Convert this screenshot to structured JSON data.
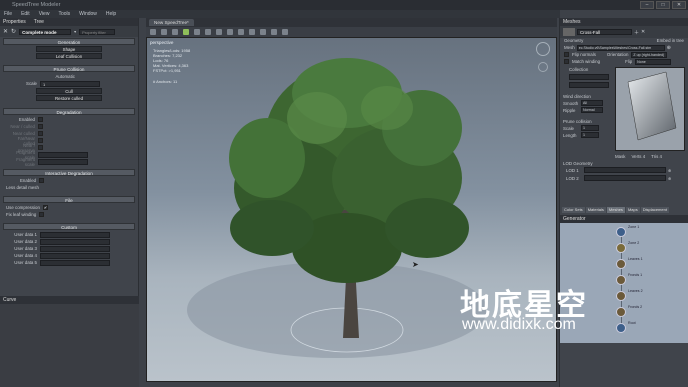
{
  "app_title": "SpeedTree Modeler",
  "menu": [
    "File",
    "Edit",
    "View",
    "Tools",
    "Window",
    "Help"
  ],
  "left_panel": {
    "tabs": [
      "Properties",
      "Tree"
    ],
    "mode_select": "Complete mode",
    "property_filter_placeholder": "Property filter",
    "generation_header": "Generation",
    "shape_button": "Shape",
    "leaf_collision_button": "Leaf Collision",
    "prune_collision_header": "Prune Collision",
    "automatic_label": "Automatic",
    "scale_label": "Scale",
    "scale_value": "1",
    "cull_button": "Cull",
    "restore_culled_button": "Restore culled",
    "degradation_header": "Degradation",
    "degradation_rows": [
      "Enabled",
      "Near / culled",
      "Near culled",
      "Far/Near culled",
      "Near / preserve",
      "Fragment scale",
      "Fragment scale"
    ],
    "interactive_degradation_header": "Interactive Degradation",
    "interactive_rows": [
      "Enabled",
      "Less detail mesh"
    ],
    "file_header": "File",
    "file_rows": [
      "Use compression",
      "Fix leaf winding"
    ],
    "custom_header": "Custom",
    "user_data": [
      "User data 1",
      "User data 2",
      "User data 3",
      "User data 4",
      "User data 5"
    ],
    "bottom_tab": "Curve"
  },
  "viewport": {
    "tab_label": "New SpeedTree*",
    "perspective_label": "perspective",
    "stats": [
      "Triangles/Lods: 1958",
      "Branches: 7,232",
      "Lods: 76",
      "Mat. Vertices: 4,363",
      "FSTPct: >1,951"
    ],
    "extra_label": "# Anchors: 11"
  },
  "right_panel": {
    "header": "Meshes",
    "mesh_name": "Cross-Fall",
    "embed_label": "Embed in tree",
    "geometry_header": "Geometry",
    "mesh_label": "Mesh",
    "mesh_path": "ec.Studio.v6\\Samples\\Meshes\\Cross-Fall.stm",
    "flip_normals": "Flip normals",
    "orientation_label": "Orientation",
    "orientation_value": "Z up (right-handed)",
    "match_winding": "Match winding",
    "flip_label": "Flip",
    "flip_value": "None",
    "collection_header": "Collection",
    "wind_header": "Wind direction",
    "smooth_label": "Smooth",
    "smooth_value": "All",
    "ripple_label": "Ripple",
    "ripple_value": "Normal",
    "prune_header": "Prune collision",
    "scale_label": "Scale",
    "scale_value": "1",
    "length_label": "Length",
    "length_value": "1",
    "lod_header": "LOD Geometry",
    "lod_rows": [
      "LOD 1",
      "LOD 2"
    ],
    "tabs": [
      "Color Sets",
      "Materials",
      "Meshes",
      "Maps",
      "Displacement"
    ],
    "generator_header": "Generator",
    "preview_controls": [
      "Mask",
      "Verts 4",
      "Tris 4"
    ],
    "nodes": [
      "Zone 1",
      "Zone 2",
      "Leaves 1",
      "Fronds 1",
      "Leaves 2",
      "Fronds 2",
      "Root"
    ]
  },
  "watermark": {
    "title": "地底星空",
    "url": "www.didixk.com"
  },
  "colors": {
    "panel": "#40444b",
    "viewport_sky": "#7f8d9b",
    "foliage": "#3f6b33"
  }
}
